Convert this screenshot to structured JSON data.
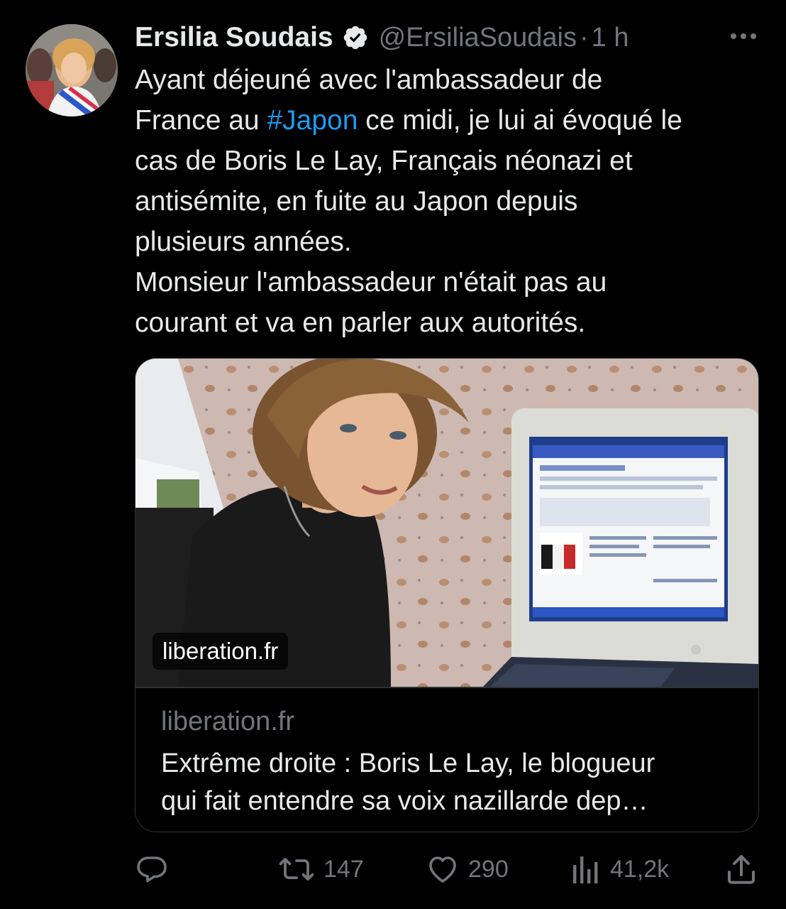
{
  "author": {
    "display_name": "Ersilia Soudais",
    "handle": "@ErsiliaSoudais",
    "separator": "·",
    "time": "1 h"
  },
  "tweet": {
    "lines": [
      "Ayant déjeuné avec l'ambassadeur de",
      "France au ",
      "cas de Boris Le Lay, Français néonazi et",
      "antisémite, en fuite au Japon depuis",
      "plusieurs années.",
      "Monsieur l'ambassadeur n'était pas au",
      "courant et va en parler aux autorités."
    ],
    "hashtag": "#Japon",
    "after_hashtag": " ce midi, je lui ai évoqué le"
  },
  "card": {
    "image_domain_chip": "liberation.fr",
    "domain": "liberation.fr",
    "title_lines": [
      "Extrême droite : Boris Le Lay, le blogueur",
      "qui fait entendre sa voix nazillarde dep…"
    ]
  },
  "actions": {
    "reply_count": "",
    "retweet_count": "147",
    "like_count": "290",
    "views_count": "41,2k"
  },
  "icons": {
    "verified": "verified-badge-icon",
    "more": "more-dots-icon",
    "reply": "reply-icon",
    "retweet": "retweet-icon",
    "like": "heart-icon",
    "views": "views-chart-icon",
    "share": "share-icon"
  },
  "colors": {
    "background": "#000000",
    "text": "#e7e9ea",
    "muted": "#71767b",
    "accent": "#1d9bf0",
    "border": "#2f3336"
  }
}
